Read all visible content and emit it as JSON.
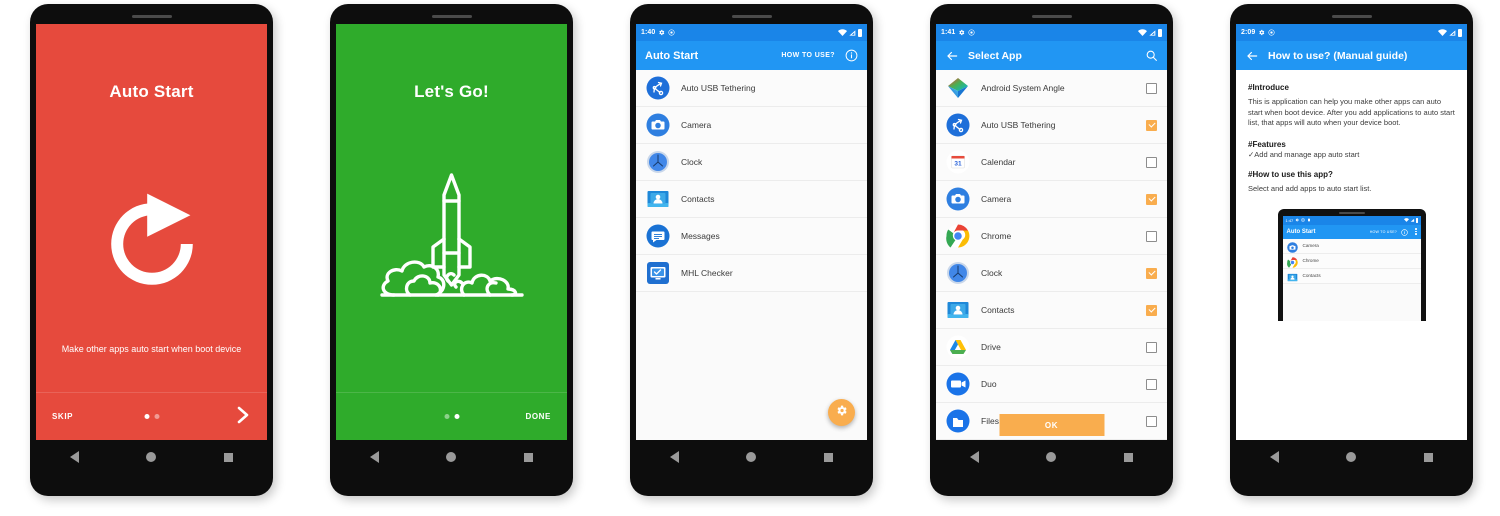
{
  "screens": [
    {
      "id": "onboarding-auto-start",
      "type": "onboarding",
      "bg_color": "#e64a3d",
      "title": "Auto Start",
      "subtitle": "Make other apps auto start when boot device",
      "art": "refresh-circular-arrow",
      "skip_label": "SKIP",
      "next_label": "›",
      "dots": 2,
      "active_dot": 0
    },
    {
      "id": "onboarding-lets-go",
      "type": "onboarding",
      "bg_color": "#2fab2b",
      "title": "Let's Go!",
      "subtitle": "",
      "art": "rocket-launch",
      "done_label": "DONE",
      "dots": 2,
      "active_dot": 1
    },
    {
      "id": "auto-start-list",
      "type": "app-list",
      "status_bar": {
        "time": "1:40",
        "icons": [
          "gear-icon",
          "circled-a-icon",
          "wifi-icon",
          "signal-icon",
          "battery-icon"
        ]
      },
      "appbar": {
        "title": "Auto Start",
        "action_label": "HOW TO USE?",
        "info_icon": "info-circle-icon"
      },
      "items": [
        {
          "label": "Auto USB Tethering",
          "icon": "usb-tethering-icon"
        },
        {
          "label": "Camera",
          "icon": "camera-icon"
        },
        {
          "label": "Clock",
          "icon": "clock-icon"
        },
        {
          "label": "Contacts",
          "icon": "contacts-icon"
        },
        {
          "label": "Messages",
          "icon": "messages-icon"
        },
        {
          "label": "MHL Checker",
          "icon": "mhl-checker-icon"
        }
      ],
      "fab": {
        "icon": "gear-icon",
        "color": "#f9ad4e"
      }
    },
    {
      "id": "select-app",
      "type": "select-list",
      "status_bar": {
        "time": "1:41",
        "icons": [
          "gear-icon",
          "circled-a-icon",
          "wifi-icon",
          "signal-icon",
          "battery-icon"
        ]
      },
      "appbar": {
        "back_icon": "back-arrow-icon",
        "title": "Select App",
        "search_icon": "search-icon"
      },
      "items": [
        {
          "label": "Android System Angle",
          "icon": "android-system-angle-icon",
          "checked": false
        },
        {
          "label": "Auto USB Tethering",
          "icon": "usb-tethering-icon",
          "checked": true
        },
        {
          "label": "Calendar",
          "icon": "calendar-icon",
          "checked": false
        },
        {
          "label": "Camera",
          "icon": "camera-icon",
          "checked": true
        },
        {
          "label": "Chrome",
          "icon": "chrome-icon",
          "checked": false
        },
        {
          "label": "Clock",
          "icon": "clock-icon",
          "checked": true
        },
        {
          "label": "Contacts",
          "icon": "contacts-icon",
          "checked": true
        },
        {
          "label": "Drive",
          "icon": "drive-icon",
          "checked": false
        },
        {
          "label": "Duo",
          "icon": "duo-icon",
          "checked": false
        },
        {
          "label": "Files",
          "icon": "files-icon",
          "checked": false
        }
      ],
      "ok_label": "OK",
      "ok_color": "#f9ad4e"
    },
    {
      "id": "how-to-use",
      "type": "guide",
      "status_bar": {
        "time": "2:09",
        "icons": [
          "gear-icon",
          "circled-a-icon",
          "wifi-icon",
          "signal-icon",
          "battery-icon"
        ]
      },
      "appbar": {
        "back_icon": "back-arrow-icon",
        "title": "How to use? (Manual guide)"
      },
      "sections": [
        {
          "heading": "#Introduce",
          "body": "This is application can help you make other apps can auto start when boot device. After you add applications to auto start list, that apps will auto when your device boot."
        },
        {
          "heading": "#Features",
          "body": "✓Add and manage app auto start"
        },
        {
          "heading": "#How to use this app?",
          "body": "Select and add apps to auto start list."
        }
      ],
      "mini_phone": {
        "status_time": "1:47",
        "appbar_title": "Auto Start",
        "appbar_action": "HOW TO USE?",
        "items": [
          {
            "label": "Camera",
            "icon": "camera-icon"
          },
          {
            "label": "Chrome",
            "icon": "chrome-icon"
          },
          {
            "label": "Contacts",
            "icon": "contacts-icon"
          }
        ]
      }
    }
  ]
}
